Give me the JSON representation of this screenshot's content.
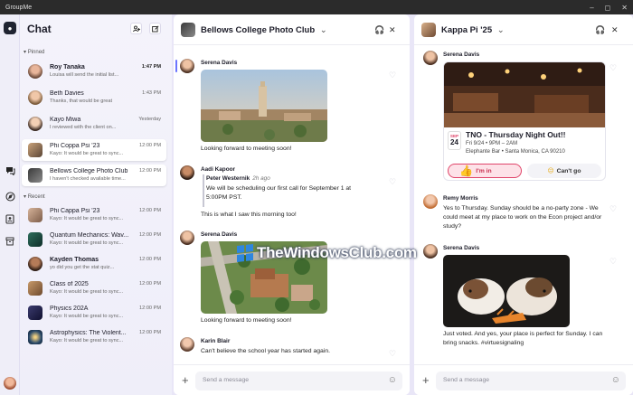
{
  "window": {
    "title": "GroupMe"
  },
  "sidebar": {
    "title": "Chat",
    "pinned_label": "Pinned",
    "recent_label": "Recent",
    "pinned": [
      {
        "name": "Roy Tanaka",
        "preview": "Louisa will send the initial list...",
        "time": "1:47 PM",
        "bold": true
      },
      {
        "name": "Beth Davies",
        "preview": "Thanks, that would be great",
        "time": "1:43 PM"
      },
      {
        "name": "Kayo Miwa",
        "preview": "I reviewed with the client on...",
        "time": "Yesterday"
      },
      {
        "name": "Phi Coppa Psi '23",
        "preview": "Kayo: It would be great to sync...",
        "time": "12:00 PM"
      },
      {
        "name": "Bellows College Photo Club",
        "preview": "I haven't checked available time...",
        "time": "12:00 PM"
      }
    ],
    "recent": [
      {
        "name": "Phi Cappa Psi '23",
        "preview": "Kayo: It would be great to sync...",
        "time": "12:00 PM"
      },
      {
        "name": "Quantum Mechanics: Wav...",
        "preview": "Kayo: It would be great to sync...",
        "time": "12:00 PM"
      },
      {
        "name": "Kayden Thomas",
        "preview": "yo did you get the stat quiz...",
        "time": "12:00 PM",
        "bold": true
      },
      {
        "name": "Class of 2025",
        "preview": "Kayo: It would be great to sync...",
        "time": "12:00 PM"
      },
      {
        "name": "Physics 202A",
        "preview": "Kayo: It would be great to sync...",
        "time": "12:00 PM"
      },
      {
        "name": "Astrophysics: The Violent...",
        "preview": "Kayo: It would be great to sync...",
        "time": "12:00 PM"
      }
    ]
  },
  "panel1": {
    "title": "Bellows College Photo Club",
    "messages": {
      "m1": {
        "sender": "Serena Davis",
        "text": "Looking forward to meeting soon!"
      },
      "m2": {
        "sender": "Aadi Kapoor",
        "quote_author": "Peter Westernik",
        "quote_ago": "2h ago",
        "quote_text": "We will be scheduling our first call for September 1 at 5:00PM PST.",
        "text": "This is what I saw this morning too!"
      },
      "m3": {
        "sender": "Serena Davis",
        "text": "Looking forward to meeting soon!"
      },
      "m4": {
        "sender": "Karin Blair",
        "text": "Can't believe the school year has started again."
      }
    },
    "composer_placeholder": "Send a message"
  },
  "panel2": {
    "title": "Kappa Pi '25",
    "event": {
      "sender": "Serena Davis",
      "month": "SEP",
      "day": "24",
      "title": "TNO - Thursday Night Out!!",
      "time": "Fri 9/24 • 9PM – 2AM",
      "location": "Elephante Bar • Santa Monica, CA 90210",
      "rsvp_yes": "I'm in",
      "rsvp_no": "Can't go"
    },
    "m2": {
      "sender": "Remy Morris",
      "text": "Yes to Thursday. Sunday should be a no-party zone - We could meet at my place to work on the Econ project and/or study?"
    },
    "m3": {
      "sender": "Serena Davis",
      "text": "Just voted. And yes, your place is perfect for Sunday. I can bring snacks. #virtuesignaling"
    },
    "composer_placeholder": "Send a message"
  },
  "watermark": {
    "text": "TheWindowsClub.com"
  },
  "colors": {
    "accent": "#6b74ff",
    "rsvp_yes_bg": "#fde2e8",
    "rsvp_yes_border": "#e0456a"
  }
}
